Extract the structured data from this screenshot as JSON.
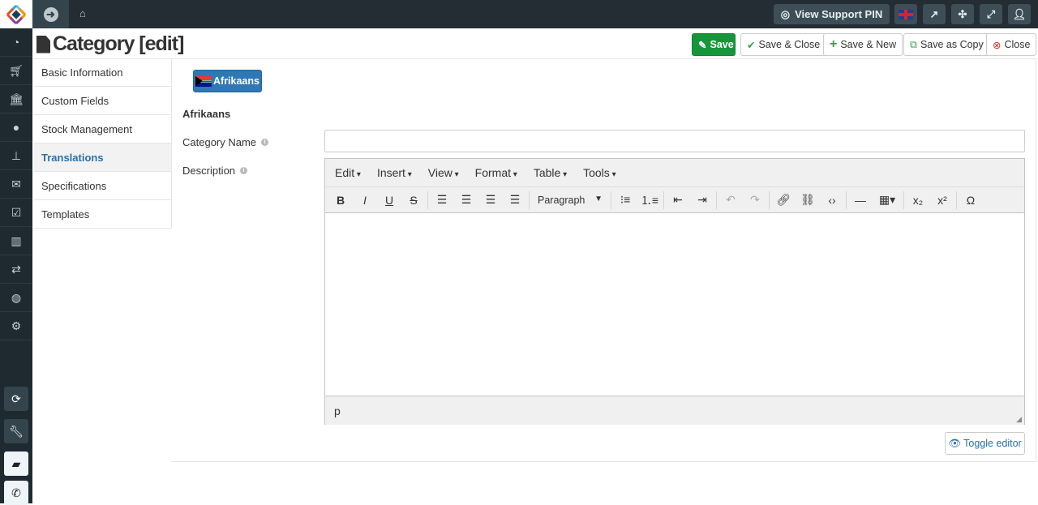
{
  "topbar": {
    "support_label": "View Support PIN",
    "icons": [
      "arrow-right-circle-icon",
      "home-icon",
      "life-ring-icon",
      "uk-flag-icon",
      "external-link-icon",
      "joomla-icon",
      "fullscreen-icon",
      "user-icon"
    ]
  },
  "sidebar": {
    "icons": [
      "dashboard-icon",
      "cart-icon",
      "bank-icon",
      "user-icon",
      "sitemap-icon",
      "envelope-icon",
      "check-square-icon",
      "bar-chart-icon",
      "exchange-icon",
      "globe-icon",
      "gear-icon"
    ],
    "bottom_icons": [
      "refresh-icon",
      "wrench-icon",
      "book-icon",
      "phone-icon"
    ]
  },
  "page": {
    "title": "Category [edit]"
  },
  "actions": {
    "save": "Save",
    "save_close": "Save & Close",
    "save_new": "Save & New",
    "save_copy": "Save as Copy",
    "close": "Close"
  },
  "colors": {
    "save": "#16963a",
    "primary": "#2f78b4",
    "topbar": "#232d33"
  },
  "tabs": [
    "Basic Information",
    "Custom Fields",
    "Stock Management",
    "Translations",
    "Specifications",
    "Templates"
  ],
  "active_tab": "Translations",
  "form": {
    "language_button": "Afrikaans",
    "language_heading": "Afrikaans",
    "name_label": "Category Name",
    "name_value": "",
    "description_label": "Description"
  },
  "editor": {
    "menus": [
      "Edit",
      "Insert",
      "View",
      "Format",
      "Table",
      "Tools"
    ],
    "block_format": "Paragraph",
    "status_path": "p",
    "toggle_label": "Toggle editor"
  }
}
